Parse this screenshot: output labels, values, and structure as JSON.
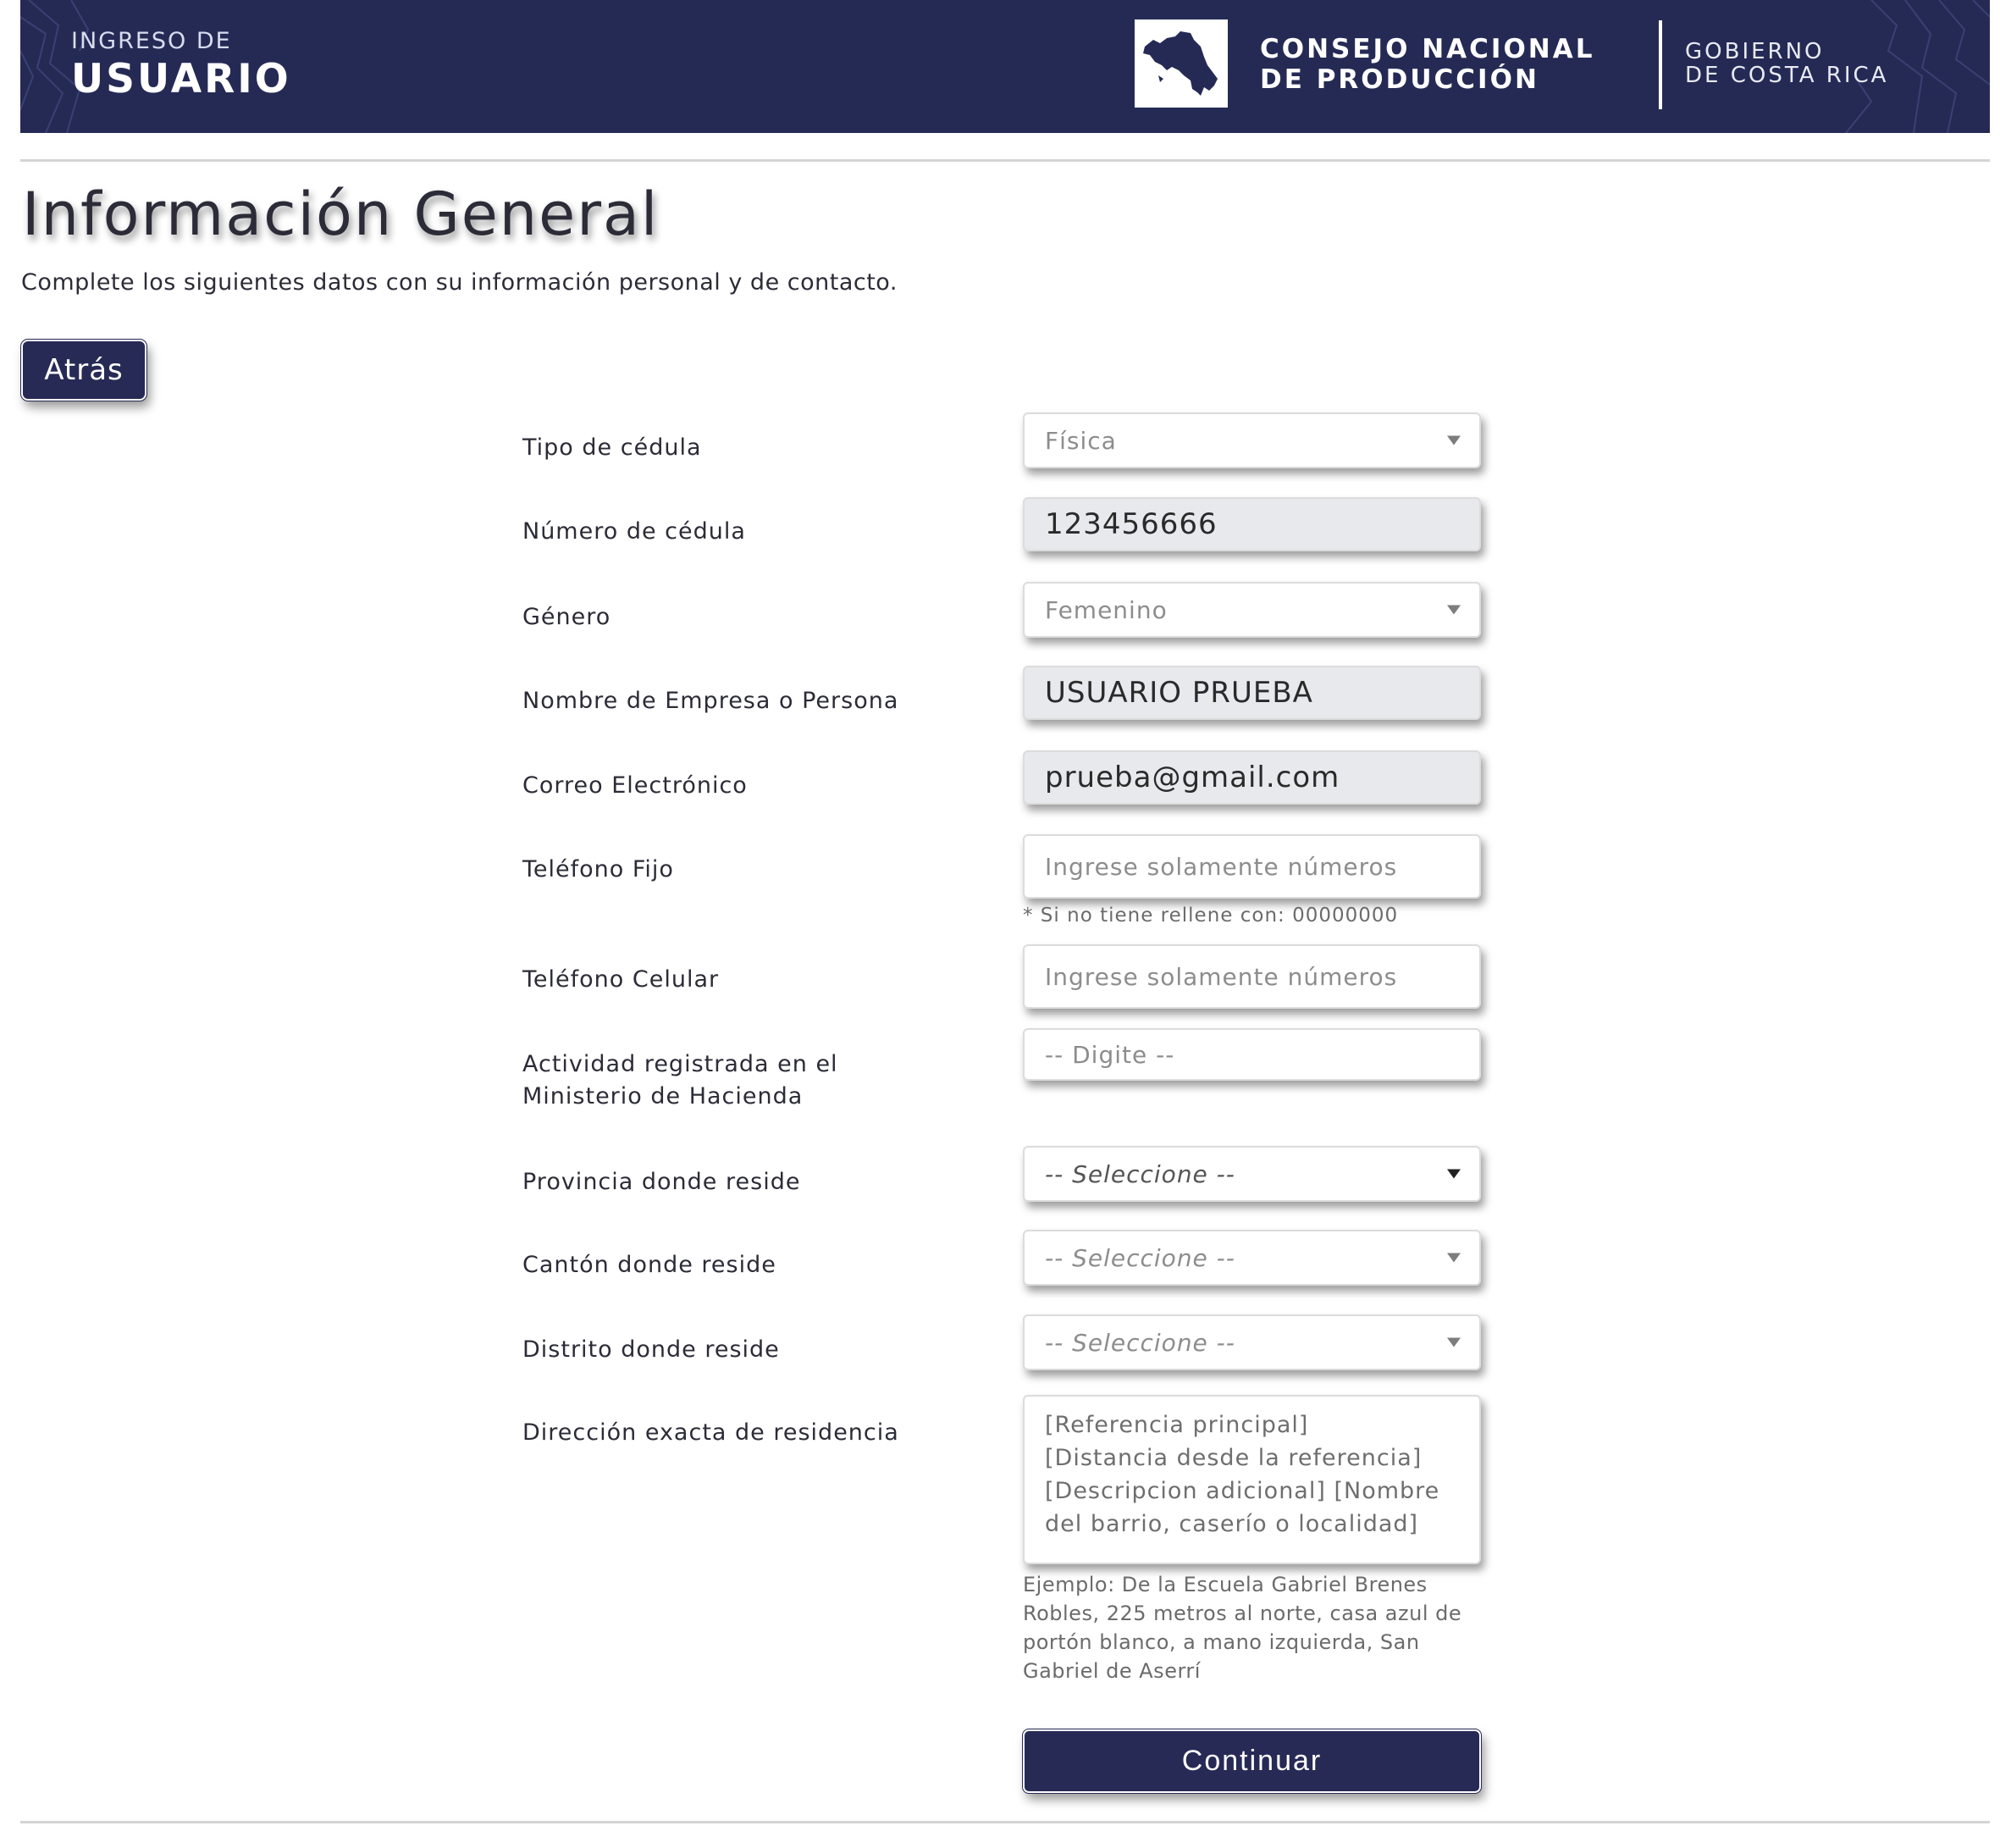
{
  "header": {
    "brand_small": "INGRESO DE",
    "brand_big": "USUARIO",
    "org_line1": "CONSEJO NACIONAL",
    "org_line2": "DE PRODUCCIÓN",
    "gov_line1": "GOBIERNO",
    "gov_line2": "DE COSTA RICA",
    "logo_icon": "costa-rica-map-icon"
  },
  "page": {
    "title": "Información General",
    "subtitle": "Complete los siguientes datos con su información personal y de contacto.",
    "back_label": "Atrás"
  },
  "form": {
    "tipo_cedula": {
      "label": "Tipo de cédula",
      "value": "Física"
    },
    "numero_cedula": {
      "label": "Número de cédula",
      "value": "123456666"
    },
    "genero": {
      "label": "Género",
      "value": "Femenino"
    },
    "nombre": {
      "label": "Nombre de Empresa o Persona",
      "value": "USUARIO PRUEBA"
    },
    "correo": {
      "label": "Correo Electrónico",
      "value": "prueba@gmail.com"
    },
    "telefono_fijo": {
      "label": "Teléfono Fijo",
      "placeholder": "Ingrese solamente números",
      "hint": "* Si no tiene rellene con: 00000000"
    },
    "telefono_celular": {
      "label": "Teléfono Celular",
      "placeholder": "Ingrese solamente números"
    },
    "actividad": {
      "label_line1": "Actividad registrada en el",
      "label_line2": "Ministerio de Hacienda",
      "placeholder": "-- Digite --"
    },
    "provincia": {
      "label": "Provincia donde reside",
      "value": "-- Seleccione --"
    },
    "canton": {
      "label": "Cantón donde reside",
      "value": "-- Seleccione --"
    },
    "distrito": {
      "label": "Distrito donde reside",
      "value": "-- Seleccione --"
    },
    "direccion": {
      "label": "Dirección exacta de residencia",
      "placeholder": "[Referencia principal]\n[Distancia desde la referencia]\n[Descripcion adicional] [Nombre\ndel barrio, caserío o localidad]",
      "example": "Ejemplo: De la Escuela Gabriel Brenes Robles, 225 metros al norte, casa azul de portón blanco, a mano izquierda, San Gabriel de Aserrí"
    },
    "continue_label": "Continuar"
  },
  "colors": {
    "brand_navy": "#252a55",
    "readonly_bg": "#e7e9ec"
  }
}
